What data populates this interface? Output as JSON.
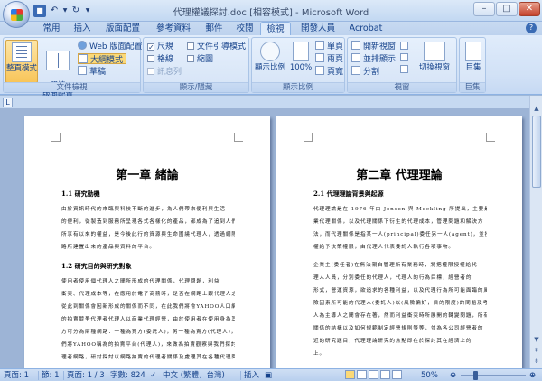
{
  "window": {
    "title": "代理權議探討.doc [相容模式] - Microsoft Word"
  },
  "tabs": [
    "常用",
    "插入",
    "版面配置",
    "參考資料",
    "郵件",
    "校閱",
    "檢視",
    "開發人員",
    "Acrobat"
  ],
  "active_tab": "檢視",
  "ribbon": {
    "views": {
      "label": "文件檢視",
      "print_layout": "整頁模式",
      "full_screen_reading": "閱讀\n版面配置",
      "web_layout": "Web 版面配置",
      "outline": "大綱模式",
      "draft": "草稿"
    },
    "show_hide": {
      "label": "顯示/隱藏",
      "ruler": "尺規",
      "ruler_checked": "✓",
      "document_map": "文件引導模式",
      "gridlines": "格線",
      "thumbnails": "縮圖",
      "message_bar": "訊息列"
    },
    "zoom": {
      "label": "顯示比例",
      "zoom": "顯示比例",
      "hundred": "100%",
      "one_page": "單頁",
      "two_pages": "兩頁",
      "page_width": "頁寬"
    },
    "window": {
      "label": "視窗",
      "new_window": "開新視窗",
      "arrange_all": "並排顯示",
      "split": "分割",
      "switch_windows": "切換視窗"
    },
    "macros": {
      "label": "巨集",
      "macros": "巨集"
    }
  },
  "document": {
    "page1": {
      "title": "第一章  緒論",
      "h1": "1.1  研究動機",
      "p1": [
        "由於資訊時代的來臨與科技不斷的進步，為人們帶來便利與生活",
        "的便利，從製造到服務所呈現各式各樣化的產品，都成為了追到人們",
        "所享有以來的權益，是今後此行的資源與生命圍繞代理人，透過網際網",
        "路所建置出來的產品與資料的平台。"
      ],
      "h2": "1.2  研究目的與研究對象",
      "p2": [
        "使用者使用個代理人之間所形成的代理關係，代理問題，利益",
        "衝突、代理成本等，在應用於電子商務時，是否在網路上跟代理人之者",
        "從此到關係會因新形成的關係而不同，在此我們將會YAHOO人口網站拍賣",
        "的拍賣競爭代理者代理人以商業代理經營，由於使用者在使用身為其分",
        "方可分為兩種網路：一種為買方(委託人)，另一種為賣方(代理人)，而我",
        "們將YAHOO稱為的拍賣平台(代理人)，來做為拍賣觀察與我們探討代",
        "理者網路，研討探討以網路拍賣的代理者關係及處理其在各種代理問題"
      ]
    },
    "page2": {
      "title": "第二章  代理理論",
      "h1": "2.1  代理理論背景與起源",
      "p1": [
        "代理理論是在 1976 年由 Jensen 與 Meckling 所提出，主要是在探討企",
        "業代理關係，以及代理關係下衍生的代理成本，管理問題和解決方",
        "法，而代理關係是指某一人(principal)委任另一人(agent)，並授",
        "權給予決策權限，由代理人代表委託人執行各項事物。"
      ],
      "p2": [
        "企業主(委任者)在無法親自管理所有業務時，將把權限授權給代",
        "理人人員，分別委任的代理人，代理人的行為目標，經營者的",
        "形式，營運資源，欲追求的各種利益，以及代理行為所可能面臨的風",
        "險因素所可能的代理人(委託人)以(風險偏好，目的限度)的問題及考量，代理",
        "人為主導人之間會存在著，然而利益衝突時所展開的轉變問題，所有",
        "關係的結構以及如何規範制定經營規則等等，並為各公司經營者的",
        "近的研究題目，代理理論研究的焦點即在於探討其在經濟上的",
        "上。"
      ]
    }
  },
  "status": {
    "page": "頁面: 1",
    "section": "節: 1",
    "pages": "頁面: 1 / 3",
    "words": "字數: 824",
    "language": "中文 (繁體，台灣)",
    "insert": "插入",
    "zoom": "50%",
    "zoom_level": 0.5
  }
}
